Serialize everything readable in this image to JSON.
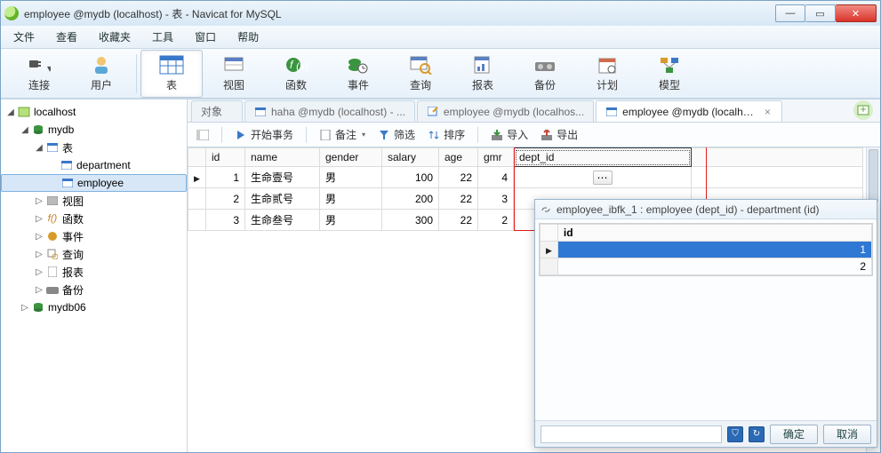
{
  "window": {
    "title": "employee @mydb (localhost) - 表 - Navicat for MySQL"
  },
  "menu": {
    "file": "文件",
    "view": "查看",
    "fav": "收藏夹",
    "tools": "工具",
    "window": "窗口",
    "help": "帮助"
  },
  "toolbar": {
    "connect": "连接",
    "user": "用户",
    "table": "表",
    "view": "视图",
    "func": "函数",
    "event": "事件",
    "query": "查询",
    "report": "报表",
    "backup": "备份",
    "schedule": "计划",
    "model": "模型"
  },
  "tree": {
    "host": "localhost",
    "db1": "mydb",
    "tables_label": "表",
    "table_department": "department",
    "table_employee": "employee",
    "views": "视图",
    "funcs": "函数",
    "events": "事件",
    "queries": "查询",
    "reports": "报表",
    "backups": "备份",
    "db2": "mydb06"
  },
  "tabs": {
    "objects": "对象",
    "t1": "haha @mydb (localhost) - ...",
    "t2": "employee @mydb (localhos...",
    "t3": "employee @mydb (localhos..."
  },
  "subtoolbar": {
    "begin": "开始事务",
    "memo": "备注",
    "filter": "筛选",
    "sort": "排序",
    "import": "导入",
    "export": "导出"
  },
  "grid": {
    "cols": {
      "id": "id",
      "name": "name",
      "gender": "gender",
      "salary": "salary",
      "age": "age",
      "gmr": "gmr",
      "dept_id": "dept_id"
    },
    "rows": [
      {
        "id": 1,
        "name": "生命壹号",
        "gender": "男",
        "salary": 100,
        "age": 22,
        "gmr": 4,
        "dept_id": ""
      },
      {
        "id": 2,
        "name": "生命贰号",
        "gender": "男",
        "salary": 200,
        "age": 22,
        "gmr": 3,
        "dept_id": ""
      },
      {
        "id": 3,
        "name": "生命叁号",
        "gender": "男",
        "salary": 300,
        "age": 22,
        "gmr": 2,
        "dept_id": ""
      }
    ]
  },
  "popup": {
    "title": "employee_ibfk_1 : employee (dept_id) - department (id)",
    "col": "id",
    "rows": [
      1,
      2
    ],
    "ok": "确定",
    "cancel": "取消",
    "search_placeholder": ""
  }
}
